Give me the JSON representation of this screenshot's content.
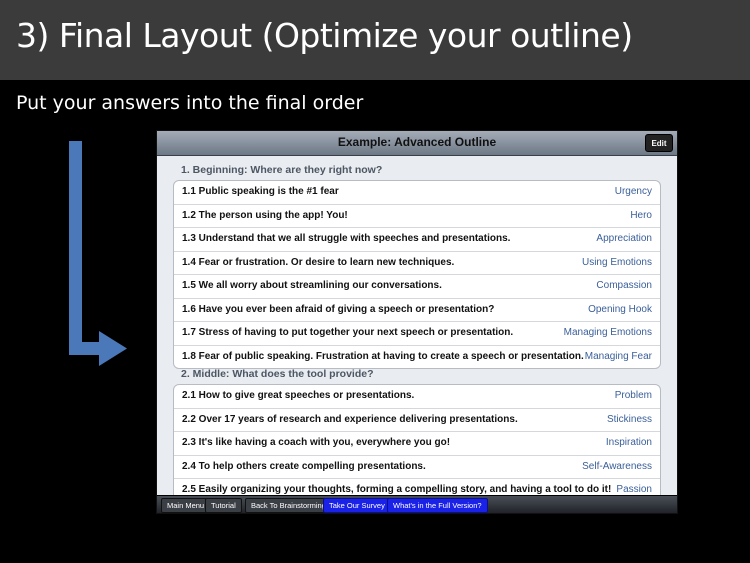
{
  "slide": {
    "title": "3) Final Layout (Optimize your outline)",
    "subtitle": "Put your answers into the final order"
  },
  "app": {
    "header_title": "Example: Advanced Outline",
    "edit_label": "Edit",
    "sections": [
      {
        "header": "1.  Beginning: Where are they right now?",
        "rows": [
          {
            "text": "1.1  Public speaking is the #1 fear",
            "tag": "Urgency"
          },
          {
            "text": "1.2  The person using the app!  You!",
            "tag": "Hero"
          },
          {
            "text": "1.3  Understand that we all struggle with speeches and presentations.",
            "tag": "Appreciation"
          },
          {
            "text": "1.4  Fear or frustration.  Or desire to learn new techniques.",
            "tag": "Using Emotions"
          },
          {
            "text": "1.5  We all worry about streamlining our conversations.",
            "tag": "Compassion"
          },
          {
            "text": "1.6  Have you ever been afraid of giving a speech or presentation?",
            "tag": "Opening Hook"
          },
          {
            "text": "1.7  Stress of having to put together your next speech or presentation.",
            "tag": "Managing Emotions"
          },
          {
            "text": "1.8  Fear of public speaking.  Frustration at having to create a speech or presentation.",
            "tag": "Managing Fear"
          }
        ]
      },
      {
        "header": "2.  Middle: What does the tool provide?",
        "rows": [
          {
            "text": "2.1  How to give great speeches or presentations.",
            "tag": "Problem"
          },
          {
            "text": "2.2  Over 17 years of research and experience delivering presentations.",
            "tag": "Stickiness"
          },
          {
            "text": "2.3  It's like having a coach with you, everywhere you go!",
            "tag": "Inspiration"
          },
          {
            "text": "2.4  To help others create compelling presentations.",
            "tag": "Self-Awareness"
          },
          {
            "text": "2.5  Easily organizing your thoughts, forming a compelling story, and having a tool to do it!",
            "tag": "Passion"
          }
        ]
      }
    ],
    "footer": {
      "main_menu": "Main Menu",
      "tutorial": "Tutorial",
      "back": "Back To Brainstorming",
      "survey": "Take Our Survey",
      "full_version": "What's in the Full Version?"
    }
  },
  "colors": {
    "arrow": "#4a78b8",
    "tag_text": "#3a5f99",
    "footer_highlight": "#1a22e8"
  }
}
